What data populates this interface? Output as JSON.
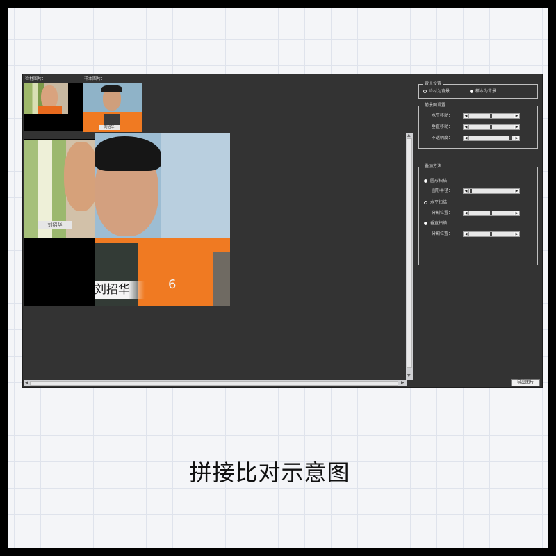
{
  "panel": {
    "material_label": "检材图片：",
    "sample_label": "样本图片："
  },
  "background_group": {
    "title": "背景设置",
    "option1": "检材为背景",
    "option2": "样本为背景",
    "selected": "option2"
  },
  "foreground_group": {
    "title": "前景图设置",
    "rows": [
      {
        "label": "水平移动：",
        "level": 0.5
      },
      {
        "label": "垂直移动：",
        "level": 0.5
      },
      {
        "label": "不透明度：",
        "level": 1.0
      }
    ]
  },
  "overlay_group": {
    "title": "叠加方法",
    "methods": [
      {
        "label": "圆形扫描",
        "param_label": "圆形半径：",
        "level": 0.05,
        "selected": true
      },
      {
        "label": "水平扫描",
        "param_label": "分割位置：",
        "level": 0.5,
        "selected": false
      },
      {
        "label": "垂直扫描",
        "param_label": "分割位置：",
        "level": 0.5,
        "selected": true
      }
    ]
  },
  "export_button": "导出图片",
  "caption": "拼接比对示意图",
  "photo": {
    "name_small": "刘招华",
    "name_large": "刘招华",
    "vest_number": "6"
  },
  "colors": {
    "window_bg": "#333333",
    "vest_orange": "#f07a22"
  }
}
